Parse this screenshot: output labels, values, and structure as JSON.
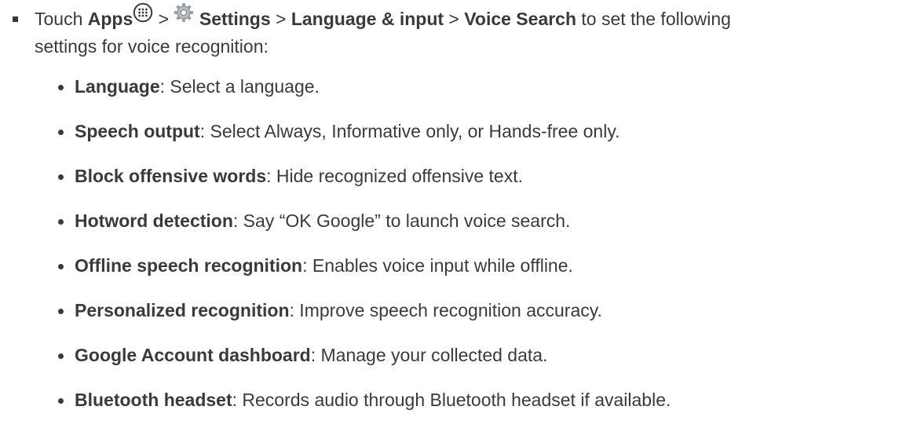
{
  "instruction": {
    "touch": "Touch ",
    "apps": "Apps",
    "sep1": " > ",
    "settings": "Settings",
    "sep2": " > ",
    "language_input": "Language & input",
    "sep3": " > ",
    "voice_search": "Voice Search",
    "tail1": " to set the following",
    "tail2": "settings for voice recognition:",
    "icons": [
      "apps-grid-icon",
      "settings-gear-icon"
    ]
  },
  "settings": [
    {
      "term": "Language",
      "desc": ": Select a language."
    },
    {
      "term": "Speech output",
      "desc": ": Select Always, Informative only, or Hands-free only."
    },
    {
      "term": "Block offensive words",
      "desc": ": Hide recognized offensive text."
    },
    {
      "term": "Hotword detection",
      "desc": ": Say “OK Google” to launch voice search."
    },
    {
      "term": "Offline speech recognition",
      "desc": ": Enables voice input while offline."
    },
    {
      "term": "Personalized recognition",
      "desc": ": Improve speech recognition accuracy."
    },
    {
      "term": "Google Account dashboard",
      "desc": ": Manage your collected data."
    },
    {
      "term": "Bluetooth headset",
      "desc": ": Records audio through Bluetooth headset if available."
    }
  ]
}
